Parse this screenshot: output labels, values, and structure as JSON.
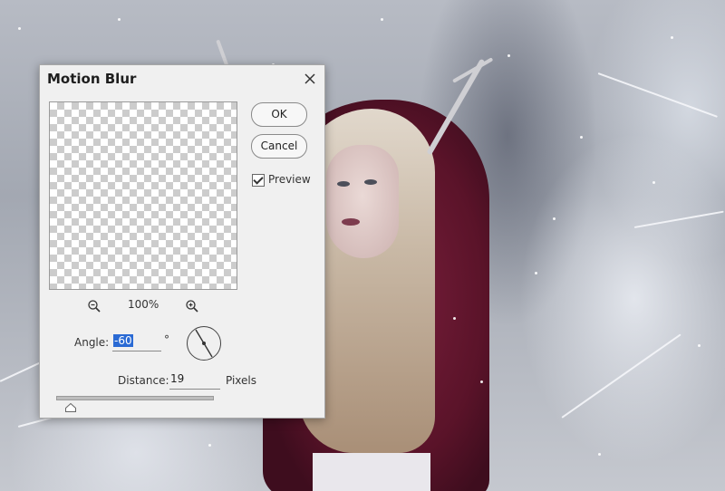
{
  "dialog": {
    "title": "Motion Blur",
    "ok_label": "OK",
    "cancel_label": "Cancel",
    "preview_label": "Preview",
    "preview_checked": true,
    "zoom_value": "100%",
    "angle_label": "Angle:",
    "angle_value": "-60",
    "angle_unit": "°",
    "distance_label": "Distance:",
    "distance_value": "19",
    "distance_unit": "Pixels"
  },
  "icons": {
    "close": "close-icon",
    "zoom_out": "zoom-out-icon",
    "zoom_in": "zoom-in-icon",
    "angle_dial": "angle-dial-icon",
    "slider_thumb": "slider-thumb-icon"
  }
}
